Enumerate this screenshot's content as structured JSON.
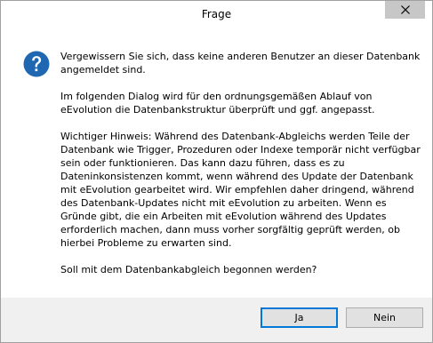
{
  "dialog": {
    "title": "Frage",
    "icon": "question-icon",
    "paragraphs": [
      "Vergewissern Sie sich, dass keine anderen Benutzer an dieser Datenbank angemeldet sind.",
      "Im folgenden Dialog wird für den ordnungsgemäßen Ablauf von eEvolution die Datenbankstruktur überprüft und ggf. angepasst.",
      "Wichtiger Hinweis: Während des Datenbank-Abgleichs werden Teile der Datenbank wie Trigger, Prozeduren oder Indexe temporär nicht verfügbar sein oder funktionieren. Das kann dazu führen, dass es zu Dateninkonsistenzen kommt, wenn während des Update der Datenbank mit eEvolution gearbeitet wird. Wir empfehlen daher dringend, während des Datenbank-Updates nicht mit eEvolution zu arbeiten. Wenn es Gründe gibt, die ein Arbeiten mit eEvolution während des Updates erforderlich machen, dann muss vorher sorgfältig geprüft werden, ob hierbei Probleme zu erwarten sind.",
      "Soll mit dem Datenbankabgleich begonnen werden?"
    ],
    "buttons": {
      "yes_label": "Ja",
      "no_label": "Nein"
    }
  },
  "colors": {
    "icon_blue": "#1f67b1",
    "focus_border": "#0078d7",
    "footer_bg": "#f0f0f0",
    "close_bg": "#c7c7c7"
  }
}
